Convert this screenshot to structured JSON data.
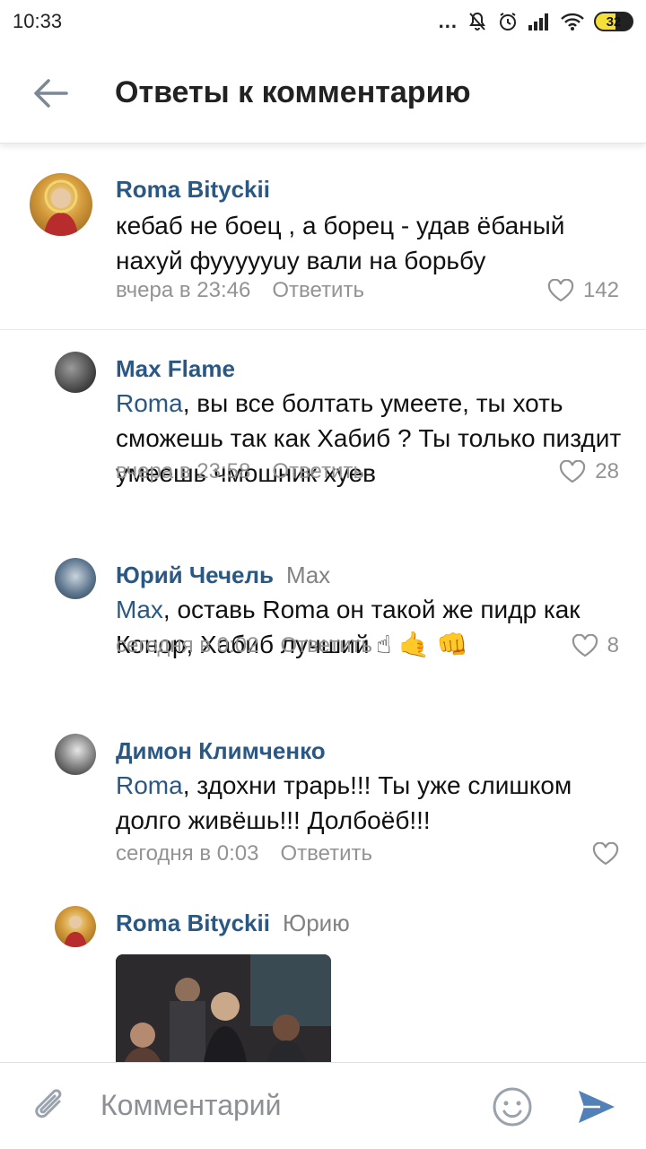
{
  "status_bar": {
    "time": "10:33",
    "dots": "...",
    "battery": "32"
  },
  "header": {
    "title": "Ответы к комментарию",
    "back_icon": "arrow-left-icon"
  },
  "comments": [
    {
      "author": "Roma Bityckii",
      "reply_to": "",
      "mention": "",
      "text": "кебаб не боец , а борец - удав ёбаный нахуй фуууууuy вали на борьбу",
      "time": "вчера в 23:46",
      "reply_label": "Ответить",
      "likes": "142"
    },
    {
      "author": "Max Flame",
      "reply_to": "",
      "mention": "Roma",
      "text": ", вы все болтать умеете, ты хоть сможешь так как Хабиб ? Ты только пиздит умеешь чмошник хуев",
      "time": "вчера в 23:58",
      "reply_label": "Ответить",
      "likes": "28"
    },
    {
      "author": "Юрий Чечель",
      "reply_to": "Max",
      "mention": "Max",
      "text": ", оставь Roma он такой же пидр как Конор, Хабиб лучший ☝ 🤙 👊",
      "time": "сегодня в 0:02",
      "reply_label": "Ответить",
      "likes": "8"
    },
    {
      "author": "Димон Климченко",
      "reply_to": "",
      "mention": "Roma",
      "text": ", здохни трарь!!! Ты уже слишком долго живёшь!!! Долбоёб!!!",
      "time": "сегодня в 0:03",
      "reply_label": "Ответить",
      "likes": ""
    },
    {
      "author": "Roma Bityckii",
      "reply_to": "Юрию",
      "mention": "",
      "text": "",
      "time": "",
      "reply_label": "",
      "likes": ""
    }
  ],
  "composer": {
    "placeholder": "Комментарий"
  },
  "colors": {
    "link": "#2a5885",
    "meta": "#939393",
    "accent": "#4a76a8"
  }
}
